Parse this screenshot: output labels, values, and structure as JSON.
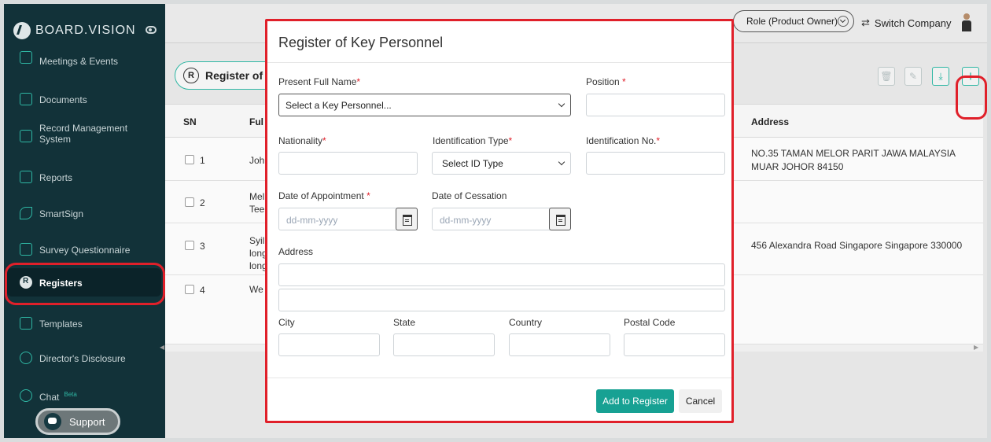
{
  "brand": {
    "name": "BOARD.VISION"
  },
  "sidebar": {
    "items": [
      {
        "label": "Meetings & Events",
        "icon": "calendar-check-icon"
      },
      {
        "label": "Documents",
        "icon": "document-icon"
      },
      {
        "label": "Record Management",
        "label2": "System",
        "icon": "records-icon"
      },
      {
        "label": "Reports",
        "icon": "report-icon"
      },
      {
        "label": "SmartSign",
        "icon": "signature-icon"
      },
      {
        "label": "Survey Questionnaire",
        "icon": "survey-icon"
      },
      {
        "label": "Registers",
        "icon": "registers-icon",
        "active": true
      },
      {
        "label": "Templates",
        "icon": "templates-icon"
      },
      {
        "label": "Director's Disclosure",
        "icon": "disclosure-icon"
      },
      {
        "label": "Chat",
        "badge": "Beta",
        "icon": "chat-icon"
      }
    ],
    "support_label": "Support"
  },
  "topbar": {
    "role": "Role (Product Owner)",
    "switch_company": "Switch Company"
  },
  "page": {
    "title": "Register of"
  },
  "table": {
    "columns": {
      "sn": "SN",
      "name": "Ful",
      "address": "Address"
    },
    "rows": [
      {
        "sn": "1",
        "name": "Joh",
        "address": "NO.35 TAMAN MELOR PARIT JAWA MALAYSIA MUAR JOHOR 84150"
      },
      {
        "sn": "2",
        "name": "Mel Tee",
        "address": ""
      },
      {
        "sn": "3",
        "name": "Syil long long",
        "address": "456 Alexandra Road Singapore Singapore 330000"
      },
      {
        "sn": "4",
        "name": "We",
        "address": ""
      }
    ]
  },
  "modal": {
    "title": "Register of Key Personnel",
    "fields": {
      "full_name": {
        "label": "Present Full Name",
        "value": "Select a Key Personnel..."
      },
      "position": {
        "label": "Position "
      },
      "nationality": {
        "label": "Nationality"
      },
      "id_type": {
        "label": "Identification Type",
        "value": "Select ID Type"
      },
      "id_no": {
        "label": "Identification No."
      },
      "date_appointment": {
        "label": "Date of Appointment ",
        "placeholder": "dd-mm-yyyy"
      },
      "date_cessation": {
        "label": "Date of Cessation",
        "placeholder": "dd-mm-yyyy"
      },
      "address": {
        "label": "Address"
      },
      "city": {
        "label": "City"
      },
      "state": {
        "label": "State"
      },
      "country": {
        "label": "Country"
      },
      "postal_code": {
        "label": "Postal Code"
      }
    },
    "required_mark": "*",
    "add_button": "Add to Register",
    "cancel_button": "Cancel"
  },
  "colors": {
    "sidebar_bg": "#123239",
    "accent": "#17a193",
    "highlight": "#e0202a"
  }
}
